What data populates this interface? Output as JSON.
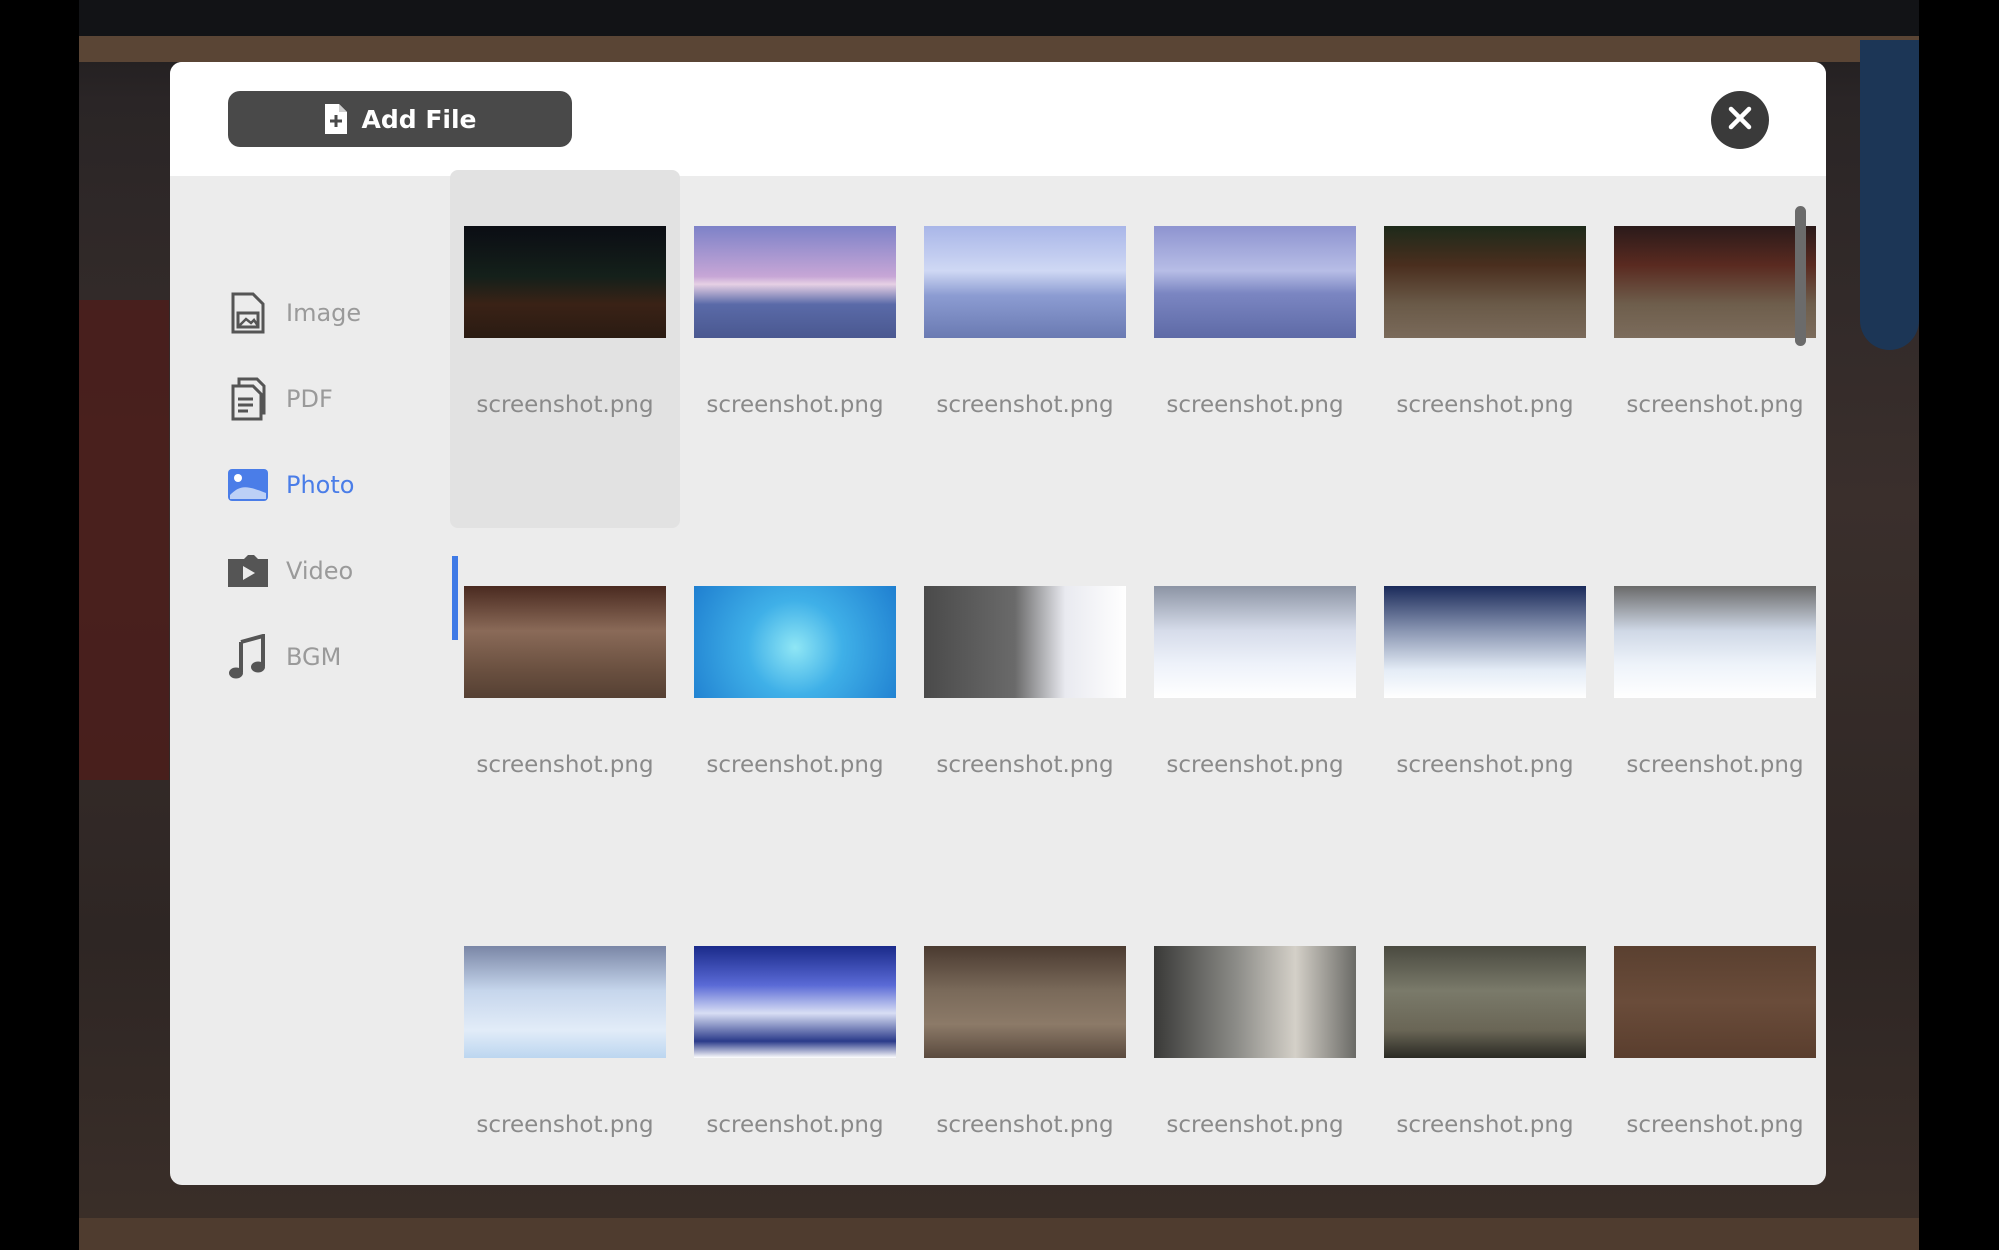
{
  "header": {
    "add_file_label": "Add File"
  },
  "sidebar": {
    "items": [
      {
        "label": "Image",
        "icon": "image-file-icon",
        "active": false
      },
      {
        "label": "PDF",
        "icon": "pdf-file-icon",
        "active": false
      },
      {
        "label": "Photo",
        "icon": "photo-icon",
        "active": true
      },
      {
        "label": "Video",
        "icon": "video-icon",
        "active": false
      },
      {
        "label": "BGM",
        "icon": "music-note-icon",
        "active": false
      }
    ]
  },
  "files": [
    {
      "name": "screenshot.png"
    },
    {
      "name": "screenshot.png"
    },
    {
      "name": "screenshot.png"
    },
    {
      "name": "screenshot.png"
    },
    {
      "name": "screenshot.png"
    },
    {
      "name": "screenshot.png"
    },
    {
      "name": "screenshot.png"
    },
    {
      "name": "screenshot.png"
    },
    {
      "name": "screenshot.png"
    },
    {
      "name": "screenshot.png"
    },
    {
      "name": "screenshot.png"
    },
    {
      "name": "screenshot.png"
    },
    {
      "name": "screenshot.png"
    },
    {
      "name": "screenshot.png"
    },
    {
      "name": "screenshot.png"
    },
    {
      "name": "screenshot.png"
    },
    {
      "name": "screenshot.png"
    },
    {
      "name": "screenshot.png"
    }
  ],
  "colors": {
    "accent": "#3f7ae6",
    "button_dark": "#494949",
    "panel_bg": "#ececec"
  }
}
